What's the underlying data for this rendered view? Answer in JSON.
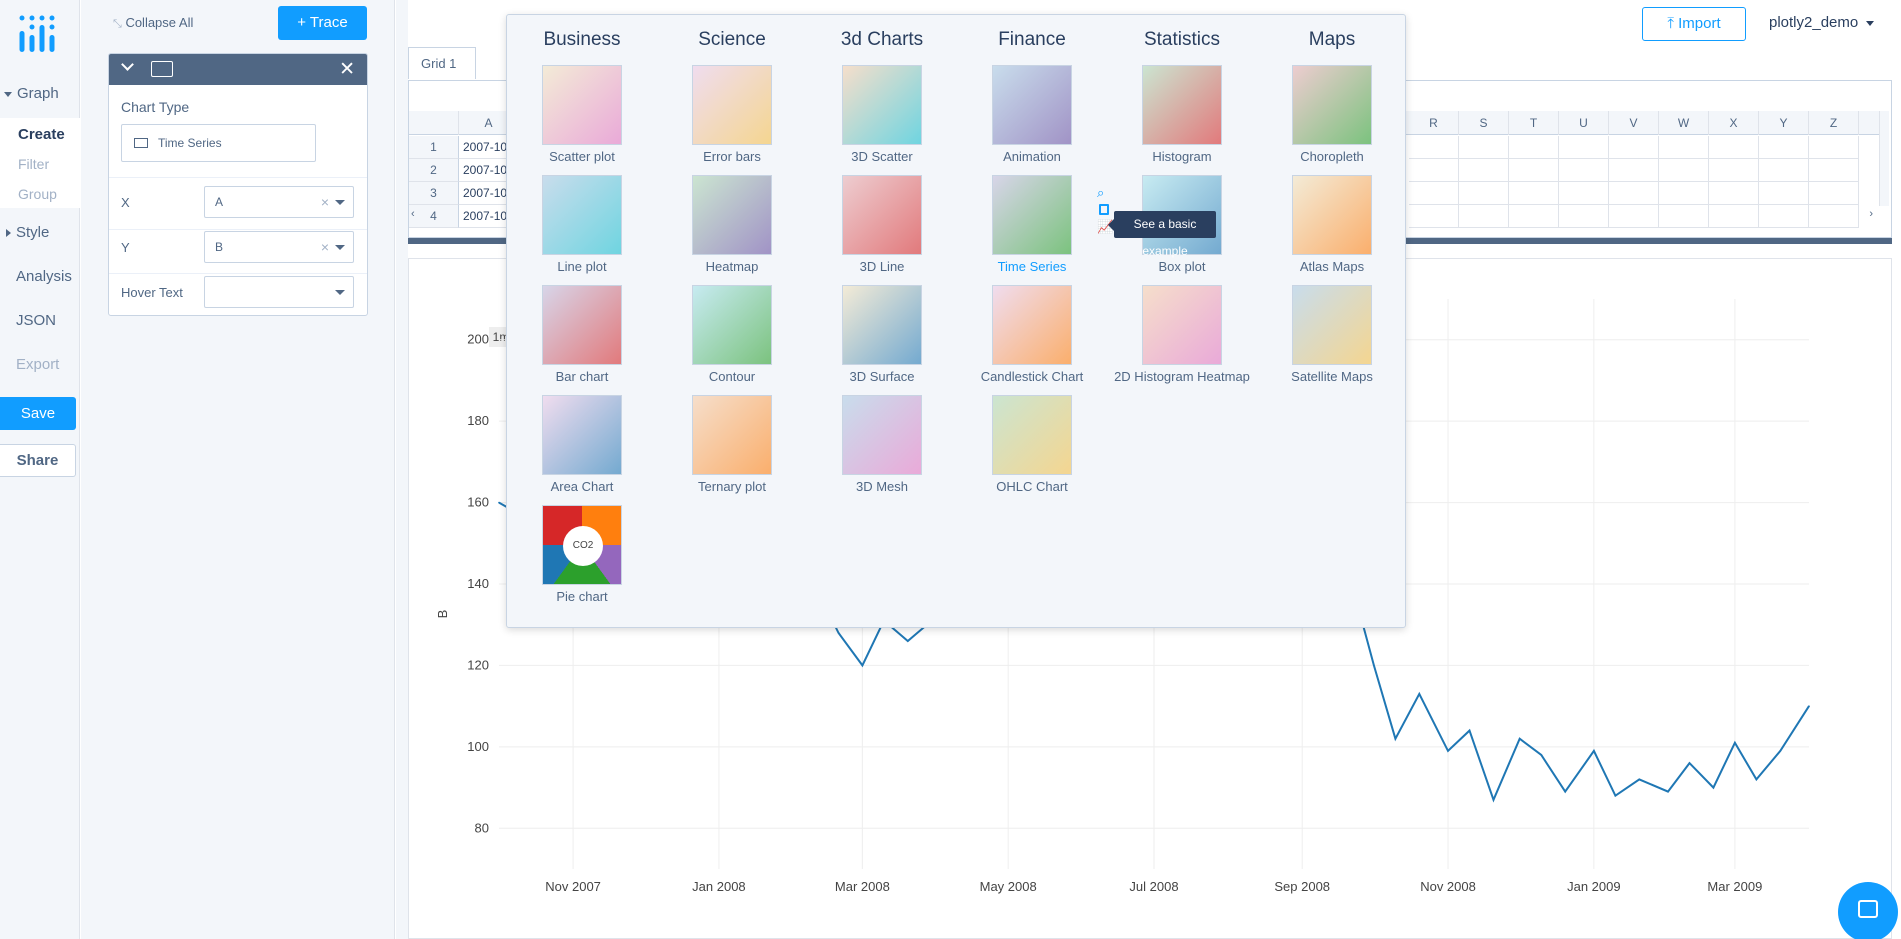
{
  "nav": {
    "graph": "Graph",
    "create": "Create",
    "filter": "Filter",
    "group": "Group",
    "style": "Style",
    "analysis": "Analysis",
    "json": "JSON",
    "export": "Export",
    "save": "Save",
    "share": "Share"
  },
  "panel": {
    "collapse_all": "Collapse All",
    "add_trace": "+ Trace",
    "chart_type_label": "Chart Type",
    "chart_type_value": "Time Series",
    "x_label": "X",
    "x_value": "A",
    "y_label": "Y",
    "y_value": "B",
    "hover_label": "Hover Text",
    "hover_value": ""
  },
  "header": {
    "import": "Import",
    "user": "plotly2_demo"
  },
  "grid": {
    "tab": "Grid 1",
    "columns_left": [
      "A"
    ],
    "columns_right": [
      "R",
      "S",
      "T",
      "U",
      "V",
      "W",
      "X",
      "Y",
      "Z"
    ],
    "rows": [
      {
        "n": "1",
        "a": "2007-10"
      },
      {
        "n": "2",
        "a": "2007-10"
      },
      {
        "n": "3",
        "a": "2007-10"
      },
      {
        "n": "4",
        "a": "2007-10"
      }
    ]
  },
  "popup": {
    "categories": [
      "Business",
      "Science",
      "3d Charts",
      "Finance",
      "Statistics",
      "Maps"
    ],
    "columns": [
      [
        "Scatter plot",
        "Line plot",
        "Bar chart",
        "Area Chart",
        "Pie chart"
      ],
      [
        "Error bars",
        "Heatmap",
        "Contour",
        "Ternary plot"
      ],
      [
        "3D Scatter",
        "3D Line",
        "3D Surface",
        "3D Mesh"
      ],
      [
        "Animation",
        "Time Series",
        "Candlestick Chart",
        "OHLC Chart"
      ],
      [
        "Histogram",
        "Box plot",
        "2D Histogram Heatmap"
      ],
      [
        "Choropleth",
        "Atlas Maps",
        "Satellite Maps"
      ]
    ],
    "active": "Time Series",
    "pie_label": "CO2",
    "tooltip": "See a basic example"
  },
  "plot": {
    "range_button": "1m",
    "ylabel": "B",
    "y_ticks": [
      "200",
      "180",
      "160",
      "140",
      "120",
      "100",
      "80"
    ],
    "x_ticks": [
      "Nov 2007",
      "Jan 2008",
      "Mar 2008",
      "May 2008",
      "Jul 2008",
      "Sep 2008",
      "Nov 2008",
      "Jan 2009",
      "Mar 2009"
    ],
    "line_color": "#1f77b4"
  },
  "chart_data": {
    "type": "line",
    "ylabel": "B",
    "ylim": [
      70,
      210
    ],
    "x_range": [
      "2007-10",
      "2009-04"
    ],
    "series": [
      {
        "x": [
          "2007-10-01",
          "2007-10-10",
          "2007-10-20",
          "2008-02-10",
          "2008-02-20",
          "2008-03-01",
          "2008-03-10",
          "2008-03-20",
          "2008-04-01",
          "2008-04-10",
          "2008-09-20",
          "2008-10-01",
          "2008-10-10",
          "2008-10-20",
          "2008-11-01",
          "2008-11-10",
          "2008-11-20",
          "2008-12-01",
          "2008-12-10",
          "2008-12-20",
          "2009-01-01",
          "2009-01-10",
          "2009-01-20",
          "2009-02-01",
          "2009-02-10",
          "2009-02-20",
          "2009-03-01",
          "2009-03-10",
          "2009-03-20",
          "2009-04-01"
        ],
        "y": [
          160,
          157,
          175,
          140,
          128,
          120,
          131,
          126,
          132,
          140,
          144,
          120,
          102,
          113,
          99,
          104,
          87,
          102,
          98,
          89,
          99,
          88,
          92,
          89,
          96,
          90,
          101,
          92,
          99,
          110
        ]
      }
    ]
  }
}
